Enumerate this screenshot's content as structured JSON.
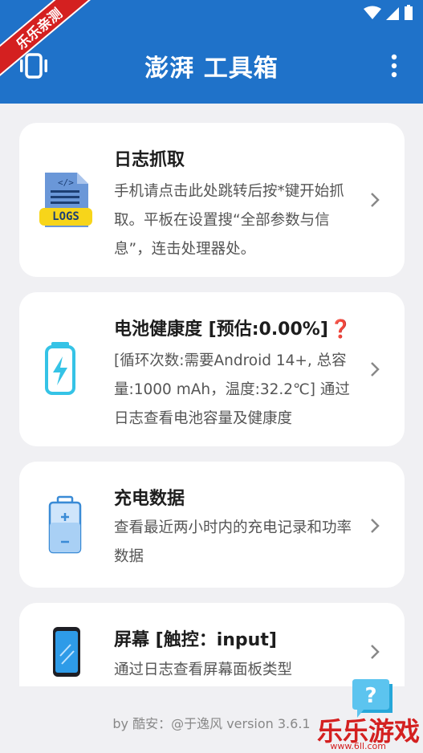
{
  "app": {
    "title": "澎湃 工具箱",
    "accent": "#1f72c9",
    "ribbon": "乐乐亲测"
  },
  "cards": [
    {
      "title": "日志抓取",
      "description": "手机请点击此处跳转后按*键开始抓取。平板在设置搜“全部参数与信息”，连击处理器处。",
      "icon": "logs-file-icon",
      "icon_label": "LOGS"
    },
    {
      "title": "电池健康度 [预估:0.00%]",
      "description": "[循环次数:需要Android 14+, 总容量:1000 mAh，温度:32.2℃] 通过日志查看电池容量及健康度",
      "icon": "battery-charging-icon",
      "badge": "❓"
    },
    {
      "title": "充电数据",
      "description": "查看最近两小时内的充电记录和功率数据",
      "icon": "battery-icon"
    },
    {
      "title": "屏幕 [触控：input]",
      "description": "通过日志查看屏幕面板类型",
      "icon": "phone-screen-icon"
    }
  ],
  "footer": {
    "text": "by 酷安：@于逸风 version 3.6.1"
  },
  "help": {
    "icon": "help-icon",
    "label": "?"
  },
  "watermark": {
    "text": "乐乐游戏",
    "url": "www.6ll.com"
  }
}
